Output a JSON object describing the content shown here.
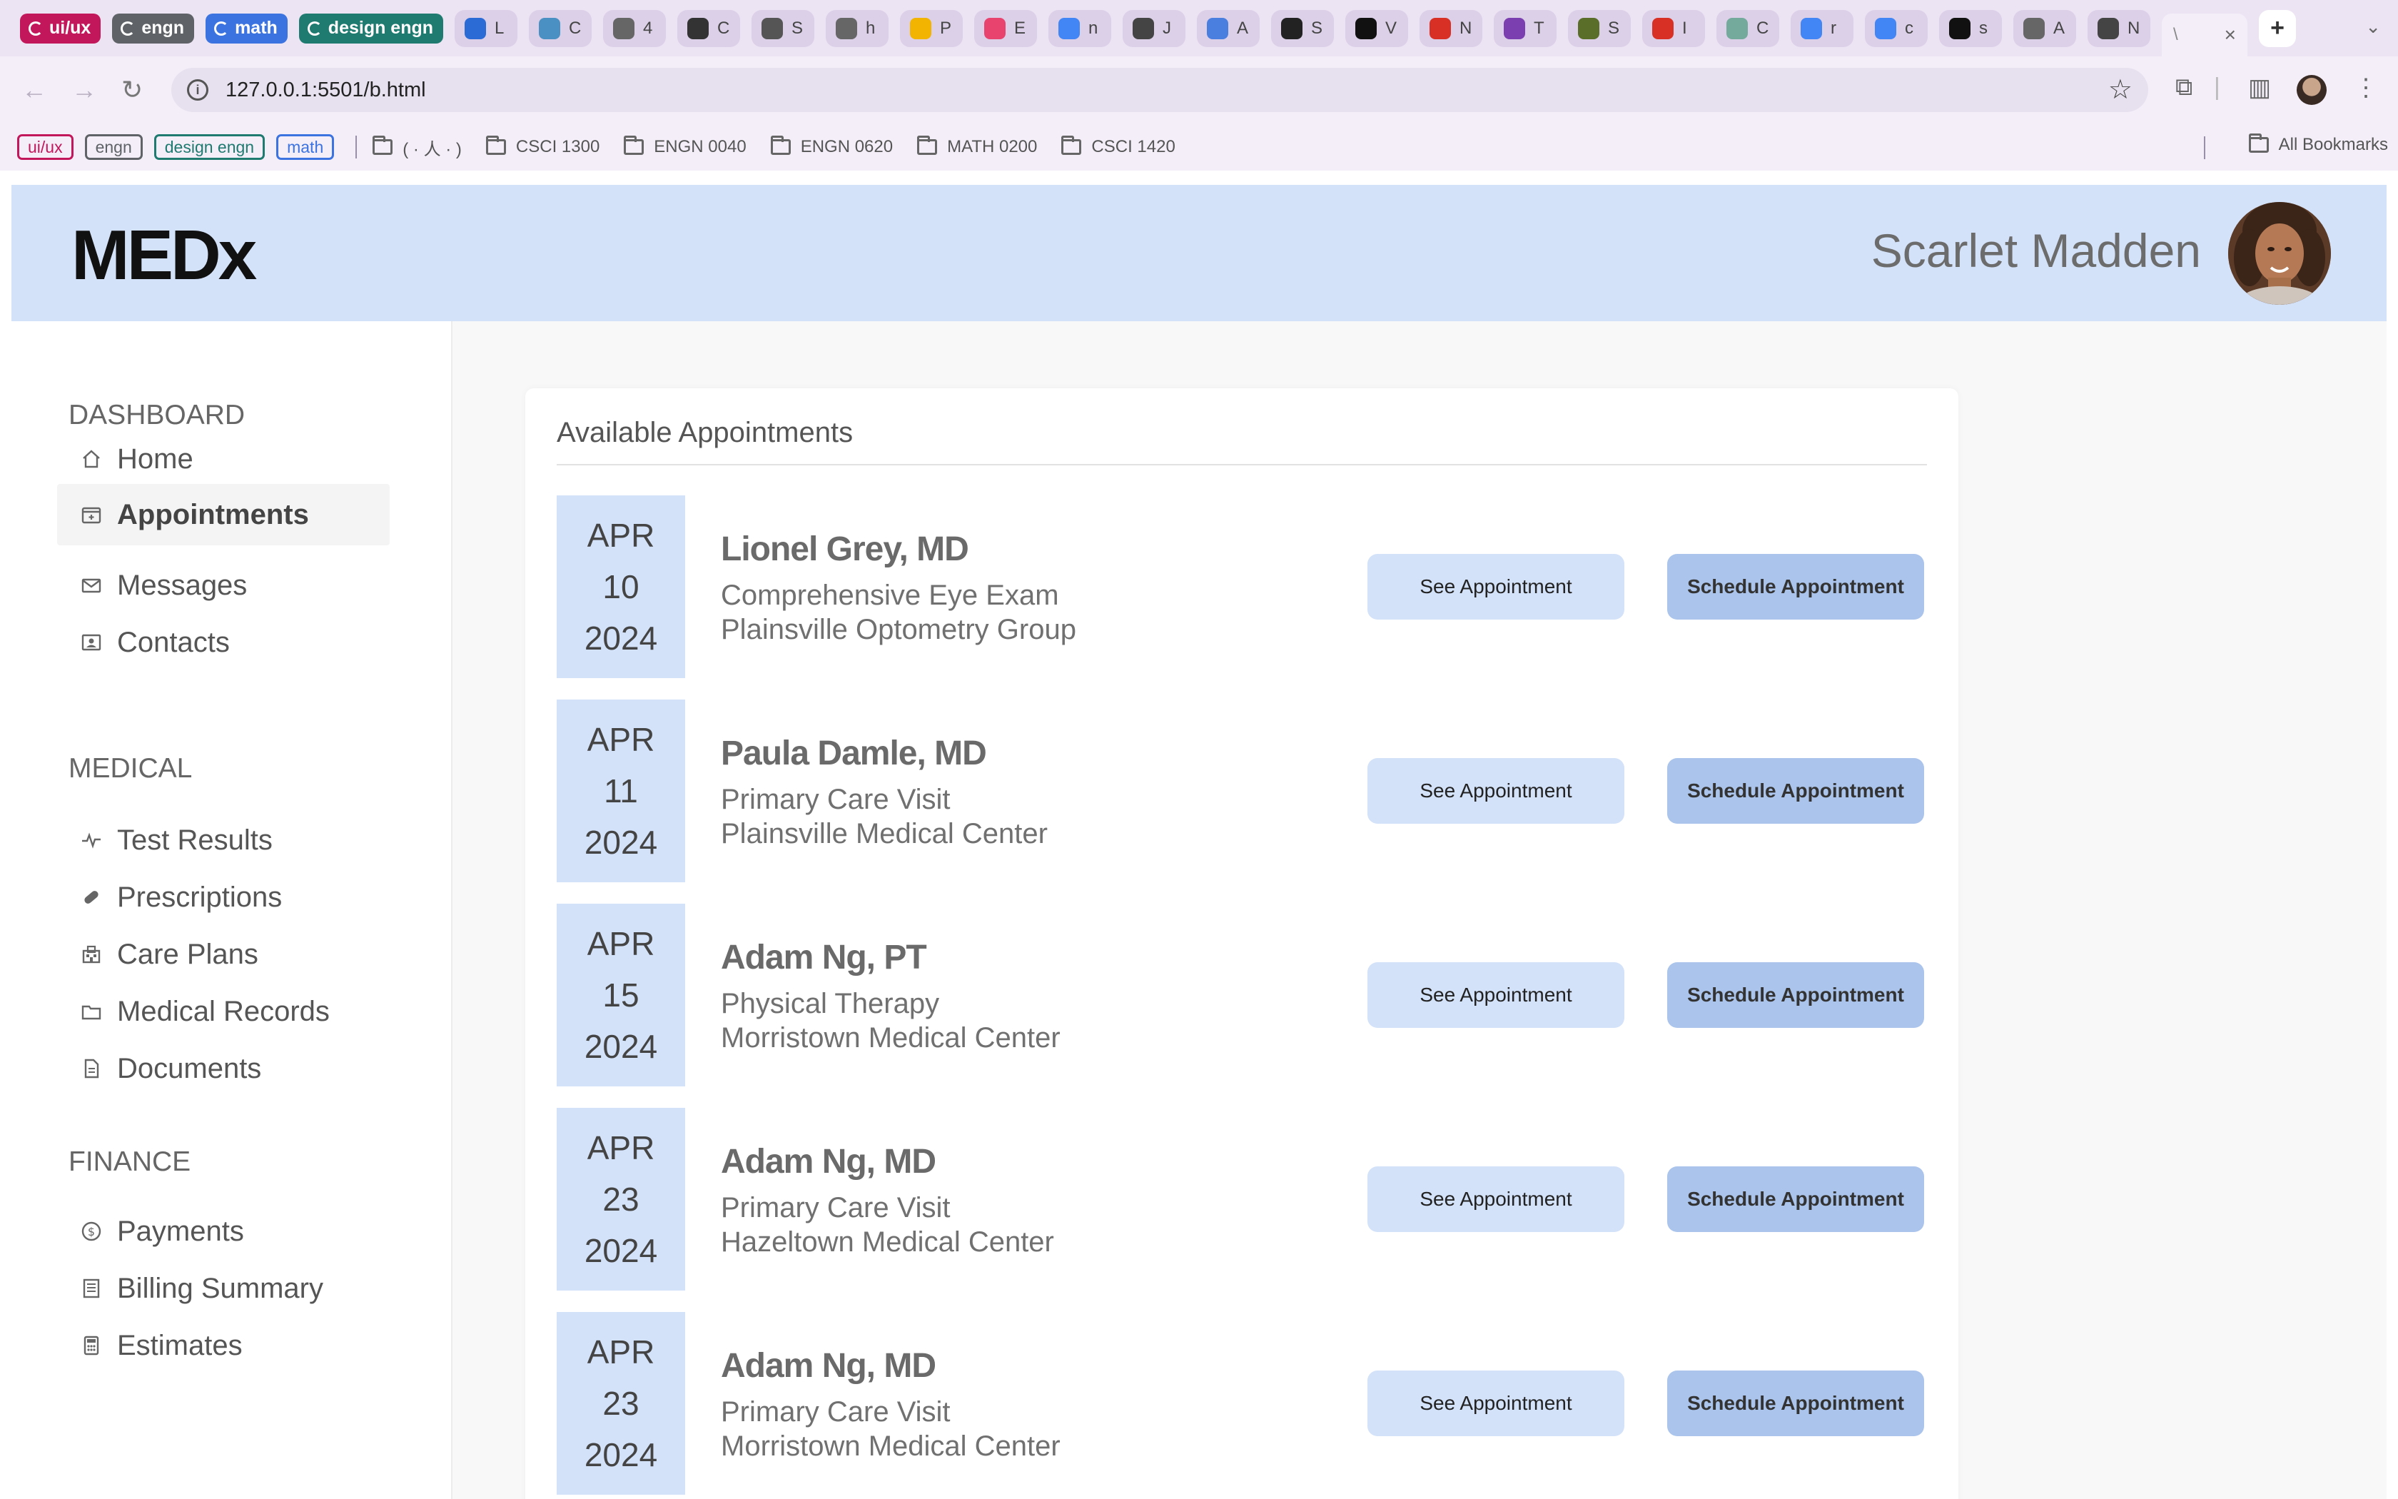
{
  "browser": {
    "tab_groups": [
      {
        "label": "ui/ux",
        "color": "#c2185b"
      },
      {
        "label": "engn",
        "color": "#5f6368"
      },
      {
        "label": "math",
        "color": "#3b73e0"
      },
      {
        "label": "design engn",
        "color": "#1f7a70"
      }
    ],
    "tabs": [
      {
        "letter": "L",
        "color": "#2b6bd6"
      },
      {
        "letter": "C",
        "color": "#4a90c2"
      },
      {
        "letter": "4",
        "color": "#666666"
      },
      {
        "letter": "C",
        "color": "#333333"
      },
      {
        "letter": "S",
        "color": "#555555"
      },
      {
        "letter": "h",
        "color": "#666666"
      },
      {
        "letter": "P",
        "color": "#f2b400"
      },
      {
        "letter": "E",
        "color": "#e8436f"
      },
      {
        "letter": "n",
        "color": "#4285f4"
      },
      {
        "letter": "J",
        "color": "#444444"
      },
      {
        "letter": "A",
        "color": "#4a7fe0"
      },
      {
        "letter": "S",
        "color": "#222222"
      },
      {
        "letter": "V",
        "color": "#111111"
      },
      {
        "letter": "N",
        "color": "#d93025"
      },
      {
        "letter": "T",
        "color": "#7b3fb0"
      },
      {
        "letter": "S",
        "color": "#5a6e2a"
      },
      {
        "letter": "I",
        "color": "#d93025"
      },
      {
        "letter": "C",
        "color": "#74aa9c"
      },
      {
        "letter": "r",
        "color": "#4285f4"
      },
      {
        "letter": "c",
        "color": "#4285f4"
      },
      {
        "letter": "s",
        "color": "#111111"
      },
      {
        "letter": "A",
        "color": "#666666"
      },
      {
        "letter": "N",
        "color": "#444444"
      }
    ],
    "active_tab_letter": "\\",
    "tab_close": "×",
    "new_tab": "+",
    "tab_list": "⌄",
    "url": "127.0.0.1:5501/b.html",
    "bookmark_groups": [
      {
        "label": "ui/ux",
        "color": "#c2185b"
      },
      {
        "label": "engn",
        "color": "#5f6368"
      },
      {
        "label": "design engn",
        "color": "#1f7a70"
      },
      {
        "label": "math",
        "color": "#3b73e0"
      }
    ],
    "bookmark_folders": [
      "( · 人 · )",
      "CSCI 1300",
      "ENGN 0040",
      "ENGN 0620",
      "MATH 0200",
      "CSCI 1420"
    ],
    "all_bookmarks": "All Bookmarks"
  },
  "app": {
    "logo": "MEDx",
    "user_name": "Scarlet Madden",
    "accent": "#d3e2f9",
    "accent_dark": "#aac4ec"
  },
  "sidebar": {
    "sections": [
      {
        "title": "DASHBOARD",
        "items": [
          {
            "label": "Home",
            "icon": "home-icon"
          },
          {
            "label": "Appointments",
            "icon": "calendar-icon",
            "active": true
          },
          {
            "label": "Messages",
            "icon": "mail-icon"
          },
          {
            "label": "Contacts",
            "icon": "contact-card-icon"
          }
        ]
      },
      {
        "title": "MEDICAL",
        "items": [
          {
            "label": "Test Results",
            "icon": "pulse-icon"
          },
          {
            "label": "Prescriptions",
            "icon": "pill-icon"
          },
          {
            "label": "Care Plans",
            "icon": "hospital-icon"
          },
          {
            "label": "Medical Records",
            "icon": "folder-icon"
          },
          {
            "label": "Documents",
            "icon": "document-icon"
          }
        ]
      },
      {
        "title": "FINANCE",
        "items": [
          {
            "label": "Payments",
            "icon": "dollar-coin-icon"
          },
          {
            "label": "Billing Summary",
            "icon": "receipt-icon"
          },
          {
            "label": "Estimates",
            "icon": "calculator-icon"
          }
        ]
      }
    ]
  },
  "main": {
    "card_title": "Available Appointments",
    "see_label": "See Appointment",
    "schedule_label": "Schedule Appointment",
    "appointments": [
      {
        "month": "APR",
        "day": "10",
        "year": "2024",
        "doctor": "Lionel Grey, MD",
        "type": "Comprehensive Eye Exam",
        "location": "Plainsville Optometry Group"
      },
      {
        "month": "APR",
        "day": "11",
        "year": "2024",
        "doctor": "Paula Damle, MD",
        "type": "Primary Care Visit",
        "location": "Plainsville Medical Center"
      },
      {
        "month": "APR",
        "day": "15",
        "year": "2024",
        "doctor": "Adam Ng, PT",
        "type": "Physical Therapy",
        "location": "Morristown Medical Center"
      },
      {
        "month": "APR",
        "day": "23",
        "year": "2024",
        "doctor": "Adam Ng, MD",
        "type": "Primary Care Visit",
        "location": "Hazeltown Medical Center"
      },
      {
        "month": "APR",
        "day": "23",
        "year": "2024",
        "doctor": "Adam Ng, MD",
        "type": "Primary Care Visit",
        "location": "Morristown Medical Center"
      }
    ]
  }
}
